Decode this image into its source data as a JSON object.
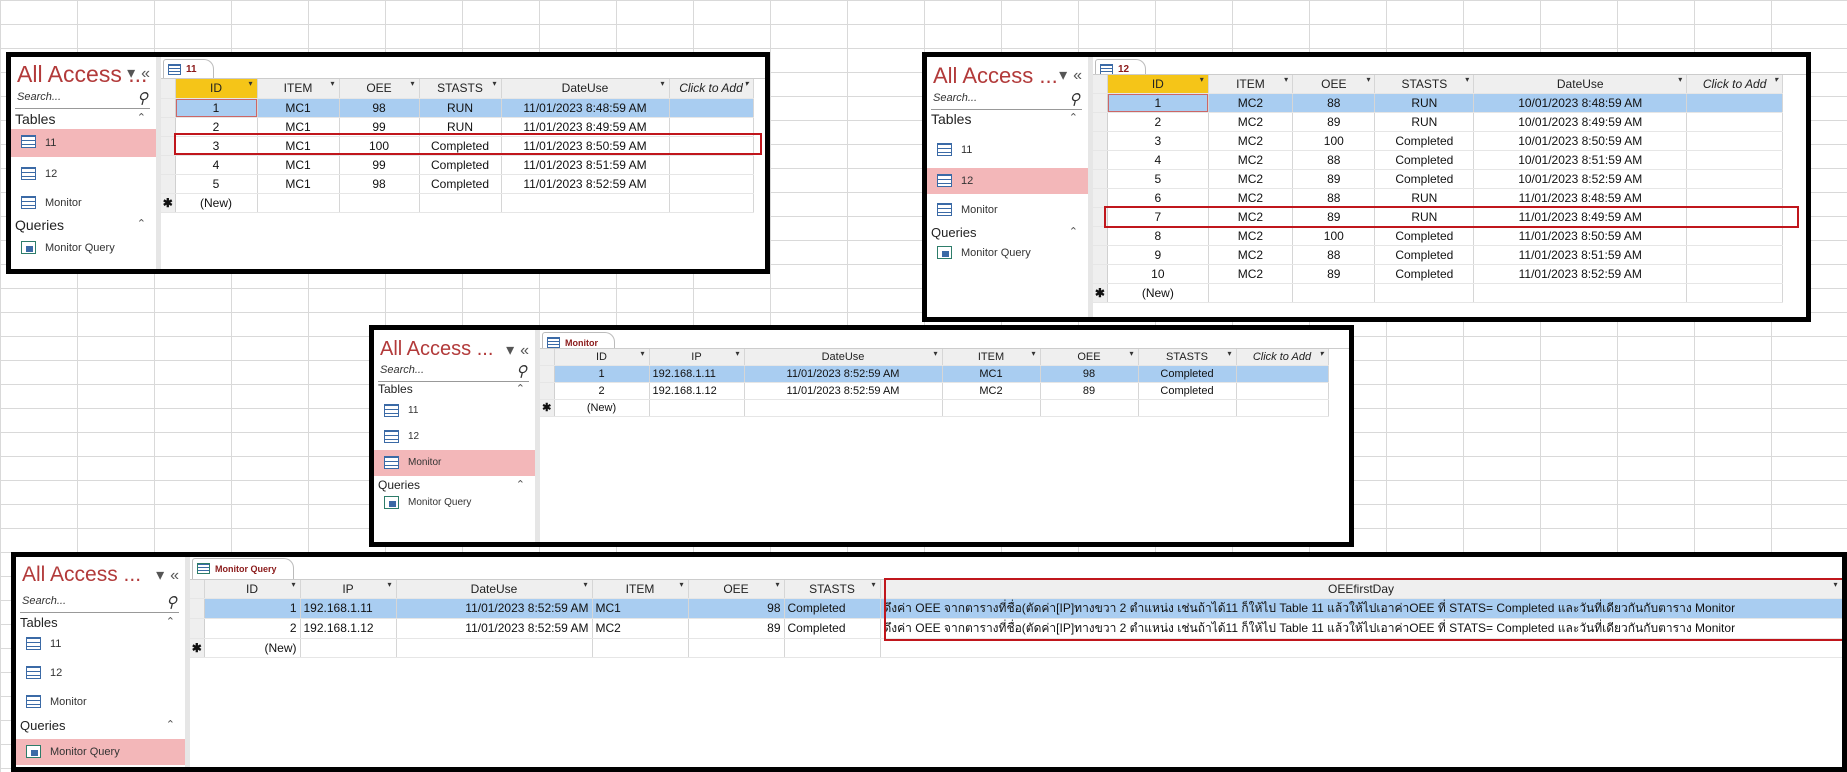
{
  "common": {
    "nav_title": "All Access ...",
    "nav_search_placeholder": "Search...",
    "tables_group": "Tables",
    "queries_group": "Queries",
    "nav_items": {
      "t11": "11",
      "t12": "12",
      "monitor": "Monitor",
      "monitor_query": "Monitor Query"
    },
    "dropdown_glyph": "▾",
    "collapse_glyph": "«",
    "group_chevron": "⌃",
    "search_icon": "search-icon",
    "new_row_marker": "✱",
    "new_row_label": "(New)"
  },
  "panel_11": {
    "tab_label": "11",
    "columns": [
      "ID",
      "ITEM",
      "OEE",
      "STASTS",
      "DateUse",
      "Click to Add"
    ],
    "rows": [
      [
        "1",
        "MC1",
        "98",
        "RUN",
        "11/01/2023 8:48:59 AM"
      ],
      [
        "2",
        "MC1",
        "99",
        "RUN",
        "11/01/2023 8:49:59 AM"
      ],
      [
        "3",
        "MC1",
        "100",
        "Completed",
        "11/01/2023 8:50:59 AM"
      ],
      [
        "4",
        "MC1",
        "99",
        "Completed",
        "11/01/2023 8:51:59 AM"
      ],
      [
        "5",
        "MC1",
        "98",
        "Completed",
        "11/01/2023 8:52:59 AM"
      ]
    ]
  },
  "panel_12": {
    "tab_label": "12",
    "columns": [
      "ID",
      "ITEM",
      "OEE",
      "STASTS",
      "DateUse",
      "Click to Add"
    ],
    "rows": [
      [
        "1",
        "MC2",
        "88",
        "RUN",
        "10/01/2023 8:48:59 AM"
      ],
      [
        "2",
        "MC2",
        "89",
        "RUN",
        "10/01/2023 8:49:59 AM"
      ],
      [
        "3",
        "MC2",
        "100",
        "Completed",
        "10/01/2023 8:50:59 AM"
      ],
      [
        "4",
        "MC2",
        "88",
        "Completed",
        "10/01/2023 8:51:59 AM"
      ],
      [
        "5",
        "MC2",
        "89",
        "Completed",
        "10/01/2023 8:52:59 AM"
      ],
      [
        "6",
        "MC2",
        "88",
        "RUN",
        "11/01/2023 8:48:59 AM"
      ],
      [
        "7",
        "MC2",
        "89",
        "RUN",
        "11/01/2023 8:49:59 AM"
      ],
      [
        "8",
        "MC2",
        "100",
        "Completed",
        "11/01/2023 8:50:59 AM"
      ],
      [
        "9",
        "MC2",
        "88",
        "Completed",
        "11/01/2023 8:51:59 AM"
      ],
      [
        "10",
        "MC2",
        "89",
        "Completed",
        "11/01/2023 8:52:59 AM"
      ]
    ]
  },
  "panel_monitor": {
    "tab_label": "Monitor",
    "columns": [
      "ID",
      "IP",
      "DateUse",
      "ITEM",
      "OEE",
      "STASTS",
      "Click to Add"
    ],
    "rows": [
      [
        "1",
        "192.168.1.11",
        "11/01/2023 8:52:59 AM",
        "MC1",
        "98",
        "Completed"
      ],
      [
        "2",
        "192.168.1.12",
        "11/01/2023 8:52:59 AM",
        "MC2",
        "89",
        "Completed"
      ]
    ]
  },
  "panel_query": {
    "tab_label": "Monitor Query",
    "columns": [
      "ID",
      "IP",
      "DateUse",
      "ITEM",
      "OEE",
      "STASTS",
      "OEEfirstDay"
    ],
    "rows": [
      [
        "1",
        "192.168.1.11",
        "11/01/2023 8:52:59 AM",
        "MC1",
        "98",
        "Completed",
        "ดึงค่า OEE จากตารางที่ชื่อ(ตัดค่า[IP]ทางขวา 2 ตำแหน่ง เช่นถ้าได้11 ก็ให้ไป Table 11 แล้วให้ไปเอาค่าOEE ที่ STATS= Completed และวันที่เดียวกันกับตาราง Monitor"
      ],
      [
        "2",
        "192.168.1.12",
        "11/01/2023 8:52:59 AM",
        "MC2",
        "89",
        "Completed",
        "ดึงค่า OEE จากตารางที่ชื่อ(ตัดค่า[IP]ทางขวา 2 ตำแหน่ง เช่นถ้าได้11 ก็ให้ไป Table 11 แล้วให้ไปเอาค่าOEE ที่ STATS= Completed และวันที่เดียวกันกับตาราง Monitor"
      ]
    ]
  }
}
